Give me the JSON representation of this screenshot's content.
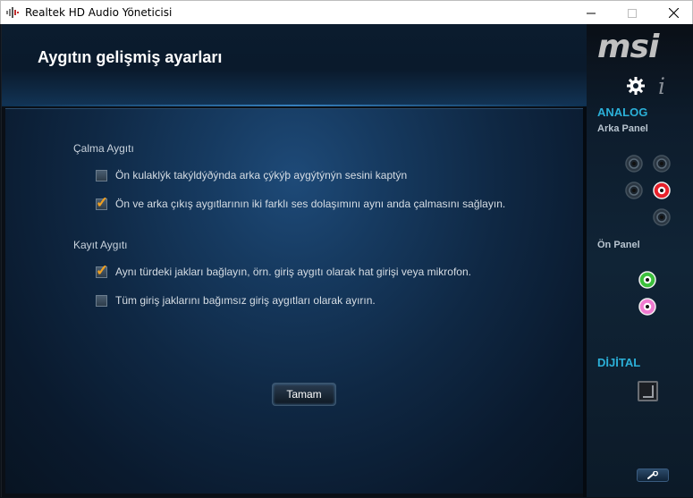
{
  "window": {
    "title": "Realtek HD Audio Yöneticisi"
  },
  "header": {
    "page_title": "Aygıtın gelişmiş ayarları"
  },
  "playback": {
    "section_label": "Çalma Aygıtı",
    "options": [
      {
        "label": "Ön kulaklýk takýldýðýnda arka çýkýþ aygýtýnýn sesini kaptýn",
        "checked": false
      },
      {
        "label": "Ön ve arka çıkış aygıtlarının iki farklı ses dolaşımını aynı anda çalmasını sağlayın.",
        "checked": true
      }
    ]
  },
  "recording": {
    "section_label": "Kayıt Aygıtı",
    "options": [
      {
        "label": "Aynı türdeki jakları bağlayın, örn. giriş aygıtı olarak hat girişi veya mikrofon.",
        "checked": true
      },
      {
        "label": "Tüm giriş jaklarını bağımsız giriş aygıtları olarak ayırın.",
        "checked": false
      }
    ]
  },
  "ok_button": {
    "label": "Tamam"
  },
  "side": {
    "logo": "msi",
    "info_glyph": "i",
    "analog_label": "ANALOG",
    "rear_panel_label": "Arka Panel",
    "front_panel_label": "Ön Panel",
    "digital_label": "DİJİTAL",
    "rear_jacks": [
      {
        "color": "#5a6a78",
        "active": false
      },
      {
        "color": "#5a6a78",
        "active": false
      },
      {
        "color": "#5a6a78",
        "active": false
      },
      {
        "color": "#e8202a",
        "active": true
      },
      {
        "color": "#5a6a78",
        "active": false
      }
    ],
    "front_jacks": [
      {
        "color": "#3cc03c",
        "active": true
      },
      {
        "color": "#f07ad0",
        "active": true
      }
    ]
  },
  "colors": {
    "accent": "#2bb0d8",
    "check": "#f0a020"
  },
  "icons": {
    "app": "speaker-icon",
    "settings": "gear-icon",
    "info": "info-icon",
    "tools": "wrench-icon"
  }
}
